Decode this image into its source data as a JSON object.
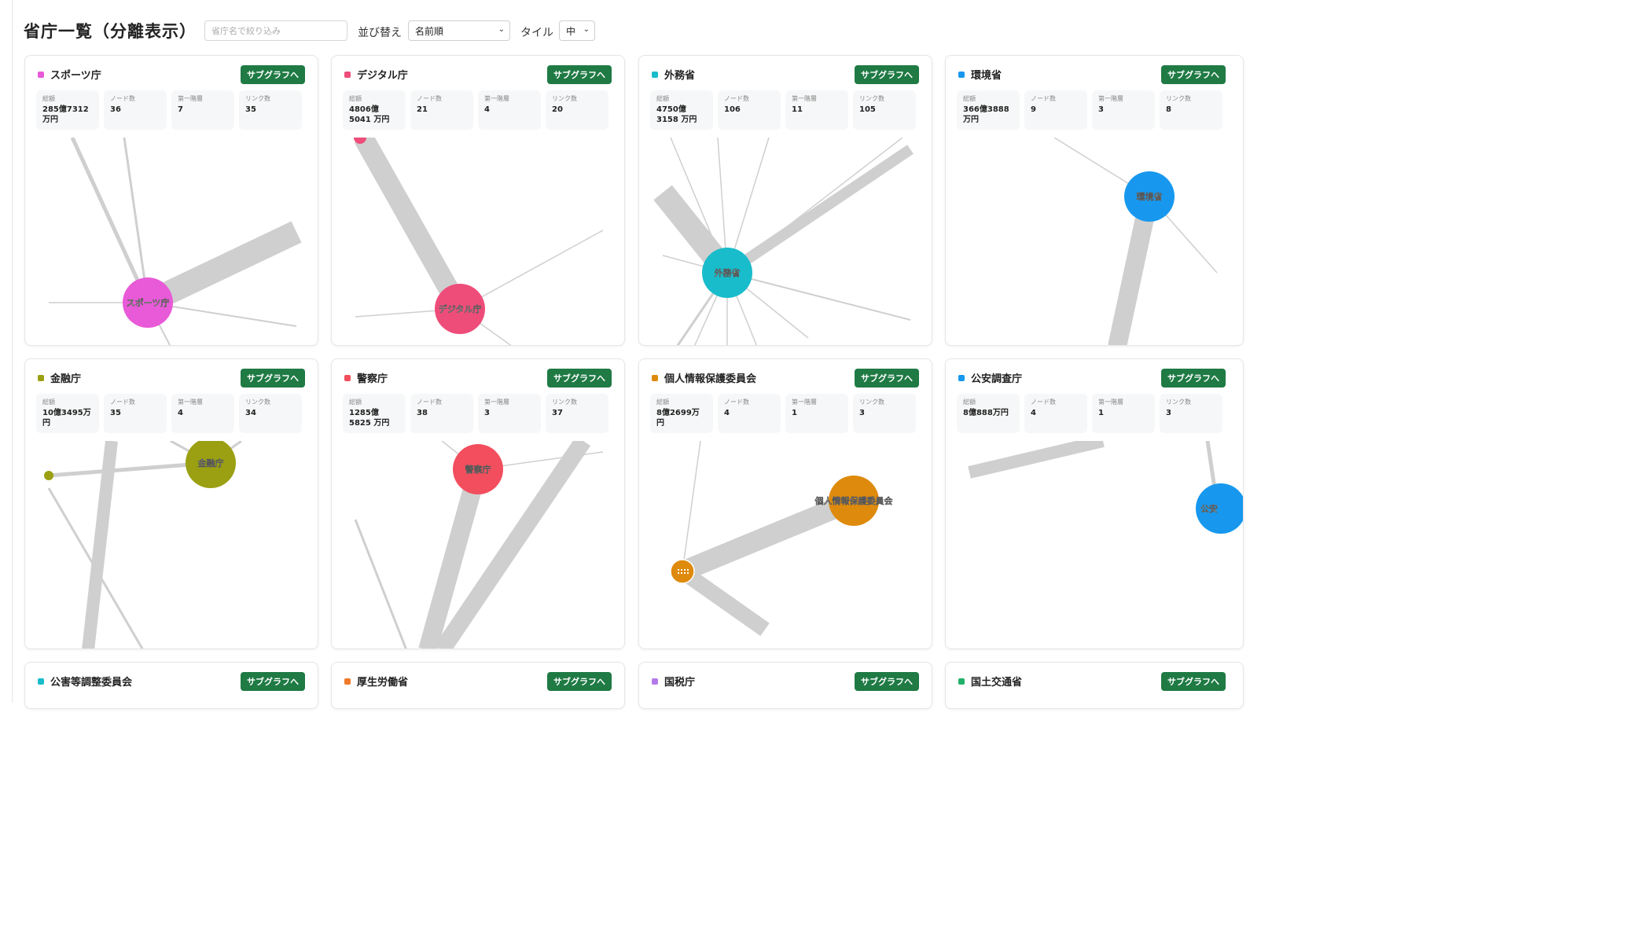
{
  "page": {
    "title": "省庁一覧（分離表示）",
    "filter_placeholder": "省庁名で絞り込み",
    "sort_label": "並び替え",
    "sort_value": "名前順",
    "tile_label": "タイル",
    "tile_value": "中"
  },
  "stat_labels": {
    "total": "総額",
    "nodes": "ノード数",
    "first": "第一階層",
    "links": "リンク数"
  },
  "subgraph_label": "サブグラフへ",
  "cards": [
    {
      "name": "スポーツ庁",
      "color": "#e85ad8",
      "total": "285億7312 万円",
      "nodes": "36",
      "first": "7",
      "links": "35",
      "node_label": "スポーツ庁"
    },
    {
      "name": "デジタル庁",
      "color": "#ee4d7a",
      "total": "4806億5041 万円",
      "nodes": "21",
      "first": "4",
      "links": "20",
      "node_label": "デジタル庁"
    },
    {
      "name": "外務省",
      "color": "#19bccb",
      "total": "4750億3158 万円",
      "nodes": "106",
      "first": "11",
      "links": "105",
      "node_label": "外務省"
    },
    {
      "name": "環境省",
      "color": "#1798ee",
      "total": "366億3888 万円",
      "nodes": "9",
      "first": "3",
      "links": "8",
      "node_label": "環境省"
    },
    {
      "name": "金融庁",
      "color": "#9aa012",
      "total": "10億3495万 円",
      "nodes": "35",
      "first": "4",
      "links": "34",
      "node_label": "金融庁"
    },
    {
      "name": "警察庁",
      "color": "#f24e5d",
      "total": "1285億5825 万円",
      "nodes": "38",
      "first": "3",
      "links": "37",
      "node_label": "警察庁"
    },
    {
      "name": "個人情報保護委員会",
      "color": "#de8a0c",
      "total": "8億2699万円",
      "nodes": "4",
      "first": "1",
      "links": "3",
      "node_label": "個人情報保護委員会"
    },
    {
      "name": "公安調査庁",
      "color": "#1798ee",
      "total": "8億888万円",
      "nodes": "4",
      "first": "1",
      "links": "3",
      "node_label": "公安"
    },
    {
      "name": "公害等調整委員会",
      "color": "#19bccb"
    },
    {
      "name": "厚生労働省",
      "color": "#f07a2a"
    },
    {
      "name": "国税庁",
      "color": "#b47be8"
    },
    {
      "name": "国土交通省",
      "color": "#22b06a"
    }
  ]
}
